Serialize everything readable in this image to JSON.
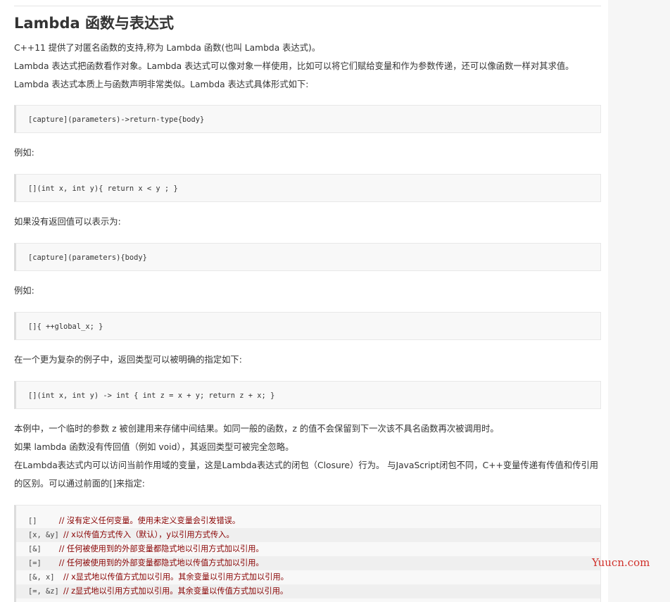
{
  "article": {
    "title": "Lambda 函数与表达式",
    "intro": [
      "C++11 提供了对匿名函数的支持,称为 Lambda 函数(也叫 Lambda 表达式)。",
      "Lambda 表达式把函数看作对象。Lambda 表达式可以像对象一样使用，比如可以将它们赋给变量和作为参数传递，还可以像函数一样对其求值。",
      "Lambda 表达式本质上与函数声明非常类似。Lambda 表达式具体形式如下:"
    ],
    "code1": "[capture](parameters)->return-type{body}",
    "example_label_1": "例如:",
    "code2": "[](int x, int y){ return x < y ; }",
    "no_return_text": "如果没有返回值可以表示为:",
    "code3": "[capture](parameters){body}",
    "example_label_2": "例如:",
    "code4": "[]{ ++global_x; }",
    "complex_text": "在一个更为复杂的例子中，返回类型可以被明确的指定如下:",
    "code5": "[](int x, int y) -> int { int z = x + y; return z + x; }",
    "notes": [
      "本例中，一个临时的参数 z 被创建用来存储中间结果。如同一般的函数，z 的值不会保留到下一次该不具名函数再次被调用时。",
      "如果 lambda 函数没有传回值（例如 void），其返回类型可被完全忽略。",
      "在Lambda表达式内可以访问当前作用域的变量，这是Lambda表达式的闭包（Closure）行为。 与JavaScript闭包不同，C++变量传递有传值和传引用的区别。可以通过前面的[]来指定:"
    ],
    "capture_table": [
      {
        "capture": "[]     ",
        "comment": "// 沒有定义任何变量。使用未定义变量会引发错误。"
      },
      {
        "capture": "[x, &y] ",
        "comment": "// x以传值方式传入（默认），y以引用方式传入。"
      },
      {
        "capture": "[&]    ",
        "comment": "// 任何被使用到的外部变量都隐式地以引用方式加以引用。"
      },
      {
        "capture": "[=]    ",
        "comment": "// 任何被使用到的外部变量都隐式地以传值方式加以引用。"
      },
      {
        "capture": "[&, x]  ",
        "comment": "// x显式地以传值方式加以引用。其余变量以引用方式加以引用。"
      },
      {
        "capture": "[=, &z] ",
        "comment": "// z显式地以引用方式加以引用。其余变量以传值方式加以引用。"
      }
    ]
  },
  "watermark": "Yuucn.com"
}
